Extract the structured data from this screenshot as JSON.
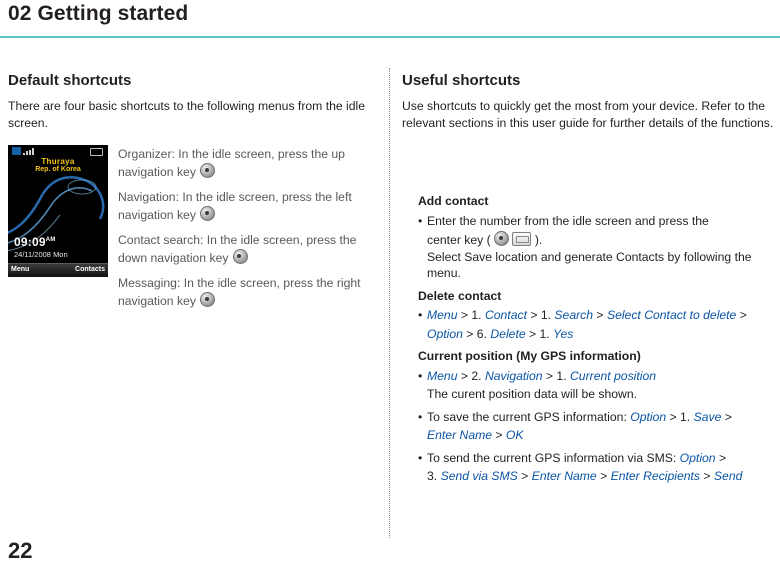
{
  "header": {
    "title": "02 Getting started",
    "rule_color": "#5bc2c1"
  },
  "page_number": "22",
  "left": {
    "heading": "Default shortcuts",
    "intro": "There are four basic shortcuts to the following menus from the idle screen.",
    "shortcuts": [
      {
        "text_before": "Organizer: In the idle screen, press the up navigation key",
        "icon": "navigation-key-up-icon"
      },
      {
        "text_before": "Navigation: In the idle screen, press the left navigation key",
        "icon": "navigation-key-left-icon"
      },
      {
        "text_before": "Contact search: In the idle screen, press the down navigation key",
        "icon": "navigation-key-down-icon"
      },
      {
        "text_before": "Messaging: In the idle screen, press the right navigation key",
        "icon": "navigation-key-right-icon"
      }
    ],
    "phone": {
      "carrier_line1": "Thuraya",
      "carrier_line2": "Rep. of Korea",
      "clock": "09:09",
      "clock_ampm": "AM",
      "date": "24/11/2008  Mon",
      "softkey_left": "Menu",
      "softkey_right": "Contacts"
    }
  },
  "right": {
    "heading": "Useful shortcuts",
    "intro": "Use shortcuts to quickly get the most from your device. Refer to the relevant sections in this user guide for further details of the functions.",
    "blocks": [
      {
        "title": "Add contact",
        "lines": [
          {
            "bullet": true,
            "segments": [
              {
                "t": "Enter the number from the idle screen and press the",
                "s": "blk"
              }
            ]
          },
          {
            "bullet": false,
            "segments": [
              {
                "t": "center key",
                "s": "blk"
              },
              {
                "t": " ( ",
                "s": "blk"
              },
              {
                "t": "KEYICON_ROUND",
                "s": "icon"
              },
              {
                "t": "  ",
                "s": "blk"
              },
              {
                "t": "KEYICON_RECT",
                "s": "icon"
              },
              {
                "t": " ).",
                "s": "blk"
              }
            ]
          },
          {
            "bullet": false,
            "segments": [
              {
                "t": "Select Save location and generate Contacts by following the menu.",
                "s": "blk"
              }
            ]
          }
        ]
      },
      {
        "title": "Delete contact",
        "lines": [
          {
            "bullet": true,
            "segments": [
              {
                "t": "Menu",
                "s": "blue"
              },
              {
                "t": " > 1. ",
                "s": "blk"
              },
              {
                "t": "Contact",
                "s": "blue"
              },
              {
                "t": " > 1. ",
                "s": "blk"
              },
              {
                "t": "Search",
                "s": "blue"
              },
              {
                "t": " > ",
                "s": "blk"
              },
              {
                "t": "Select Contact to delete",
                "s": "blue"
              },
              {
                "t": " >",
                "s": "blk"
              }
            ]
          },
          {
            "bullet": false,
            "segments": [
              {
                "t": "Option",
                "s": "blue"
              },
              {
                "t": " > 6. ",
                "s": "blk"
              },
              {
                "t": "Delete",
                "s": "blue"
              },
              {
                "t": " > 1. ",
                "s": "blk"
              },
              {
                "t": "Yes",
                "s": "blue"
              }
            ]
          }
        ]
      },
      {
        "title": "Current position (My GPS information)",
        "lines": [
          {
            "bullet": true,
            "segments": [
              {
                "t": "Menu",
                "s": "blue"
              },
              {
                "t": " > 2. ",
                "s": "blk"
              },
              {
                "t": "Navigation",
                "s": "blue"
              },
              {
                "t": " > 1. ",
                "s": "blk"
              },
              {
                "t": "Current position",
                "s": "blue"
              }
            ]
          },
          {
            "bullet": false,
            "segments": [
              {
                "t": "The curent position data will be shown.",
                "s": "blk"
              }
            ]
          }
        ]
      },
      {
        "title": "",
        "lines": [
          {
            "bullet": true,
            "segments": [
              {
                "t": "To save the current GPS information: ",
                "s": "blk"
              },
              {
                "t": "Option",
                "s": "blue"
              },
              {
                "t": " > 1. ",
                "s": "blk"
              },
              {
                "t": "Save",
                "s": "blue"
              },
              {
                "t": " >",
                "s": "blk"
              }
            ]
          },
          {
            "bullet": false,
            "segments": [
              {
                "t": "Enter Name",
                "s": "blue"
              },
              {
                "t": " > ",
                "s": "blk"
              },
              {
                "t": "OK",
                "s": "blue"
              }
            ]
          }
        ]
      },
      {
        "title": "",
        "lines": [
          {
            "bullet": true,
            "segments": [
              {
                "t": "To send the current GPS information via SMS: ",
                "s": "blk"
              },
              {
                "t": "Option",
                "s": "blue"
              },
              {
                "t": " >",
                "s": "blk"
              }
            ]
          },
          {
            "bullet": false,
            "segments": [
              {
                "t": "3. ",
                "s": "blk"
              },
              {
                "t": "Send via SMS",
                "s": "blue"
              },
              {
                "t": " > ",
                "s": "blk"
              },
              {
                "t": "Enter Name",
                "s": "blue"
              },
              {
                "t": " > ",
                "s": "blk"
              },
              {
                "t": "Enter Recipients",
                "s": "blue"
              },
              {
                "t": " > ",
                "s": "blk"
              },
              {
                "t": "Send",
                "s": "blue"
              }
            ]
          }
        ]
      }
    ]
  }
}
